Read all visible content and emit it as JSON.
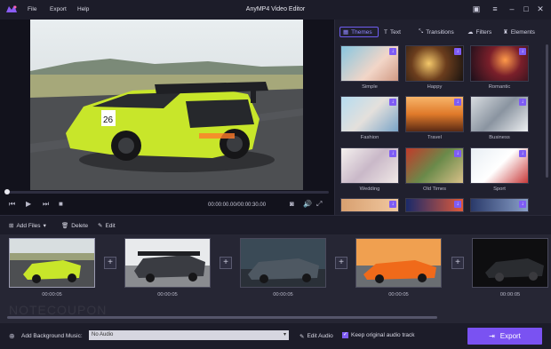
{
  "app": {
    "title": "AnyMP4 Video Editor"
  },
  "menu": {
    "file": "File",
    "export": "Export",
    "help": "Help"
  },
  "player": {
    "time": "00:00:00.00/00:00:30.00"
  },
  "tabs": {
    "themes": "Themes",
    "text": "Text",
    "transitions": "Transitions",
    "filters": "Filters",
    "elements": "Elements"
  },
  "themes": [
    {
      "label": "Simple"
    },
    {
      "label": "Happy"
    },
    {
      "label": "Romantic"
    },
    {
      "label": "Fashion"
    },
    {
      "label": "Travel"
    },
    {
      "label": "Business"
    },
    {
      "label": "Wedding"
    },
    {
      "label": "Old Times"
    },
    {
      "label": "Sport"
    }
  ],
  "toolbar": {
    "add_files": "Add Files",
    "delete": "Delete",
    "edit": "Edit"
  },
  "clips": [
    {
      "time": "00:00:05"
    },
    {
      "time": "00:00:05"
    },
    {
      "time": "00:00:05"
    },
    {
      "time": "00:00:05"
    },
    {
      "time": "00:00:05"
    }
  ],
  "footer": {
    "bgm_label": "Add Background Music:",
    "bgm_value": "No Audio",
    "edit_audio": "Edit Audio",
    "keep_audio": "Keep original audio track",
    "export": "Export"
  },
  "watermark": "NOTECOUPON",
  "colors": {
    "accent": "#7a52f2",
    "background": "#1c1c29"
  }
}
